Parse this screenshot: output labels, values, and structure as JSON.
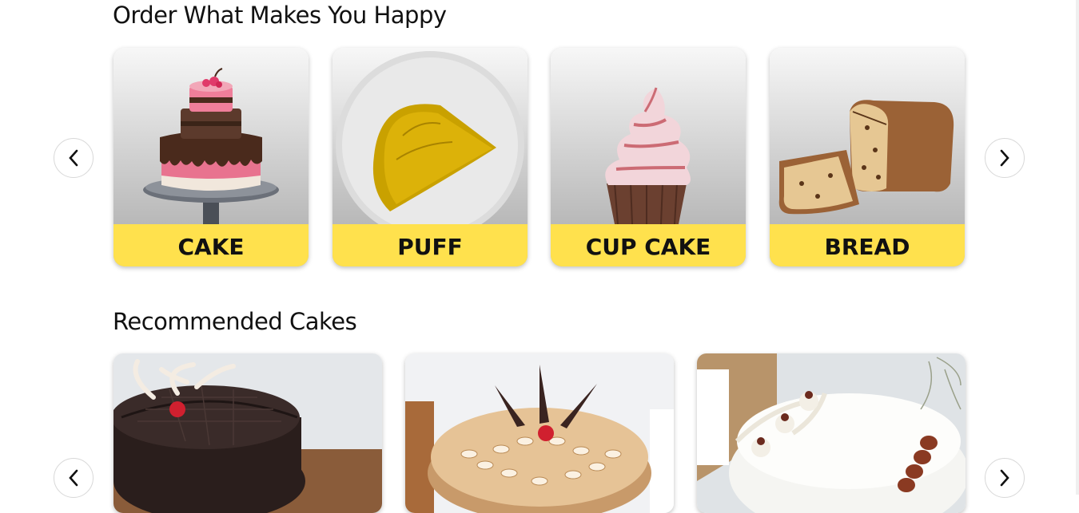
{
  "sections": {
    "categories": {
      "title": "Order What Makes You Happy",
      "items": [
        {
          "label": "CAKE",
          "icon": "tiered-cake-image"
        },
        {
          "label": "PUFF",
          "icon": "puff-pastry-image"
        },
        {
          "label": "CUP CAKE",
          "icon": "cupcake-image"
        },
        {
          "label": "BREAD",
          "icon": "bread-loaf-image"
        }
      ],
      "prev_icon": "chevron-left-icon",
      "next_icon": "chevron-right-icon",
      "prev_glyph": "‹",
      "next_glyph": "›"
    },
    "recommended": {
      "title": "Recommended Cakes",
      "items": [
        {
          "icon": "chocolate-truffle-cake-image"
        },
        {
          "icon": "butterscotch-cake-image"
        },
        {
          "icon": "white-forest-cake-image"
        }
      ],
      "prev_icon": "chevron-left-icon",
      "next_icon": "chevron-right-icon"
    }
  },
  "colors": {
    "label_band": "#ffe14d",
    "card_gradient_top": "#f7f7f7",
    "card_gradient_bottom": "#a9a9a9",
    "text": "#111111"
  }
}
